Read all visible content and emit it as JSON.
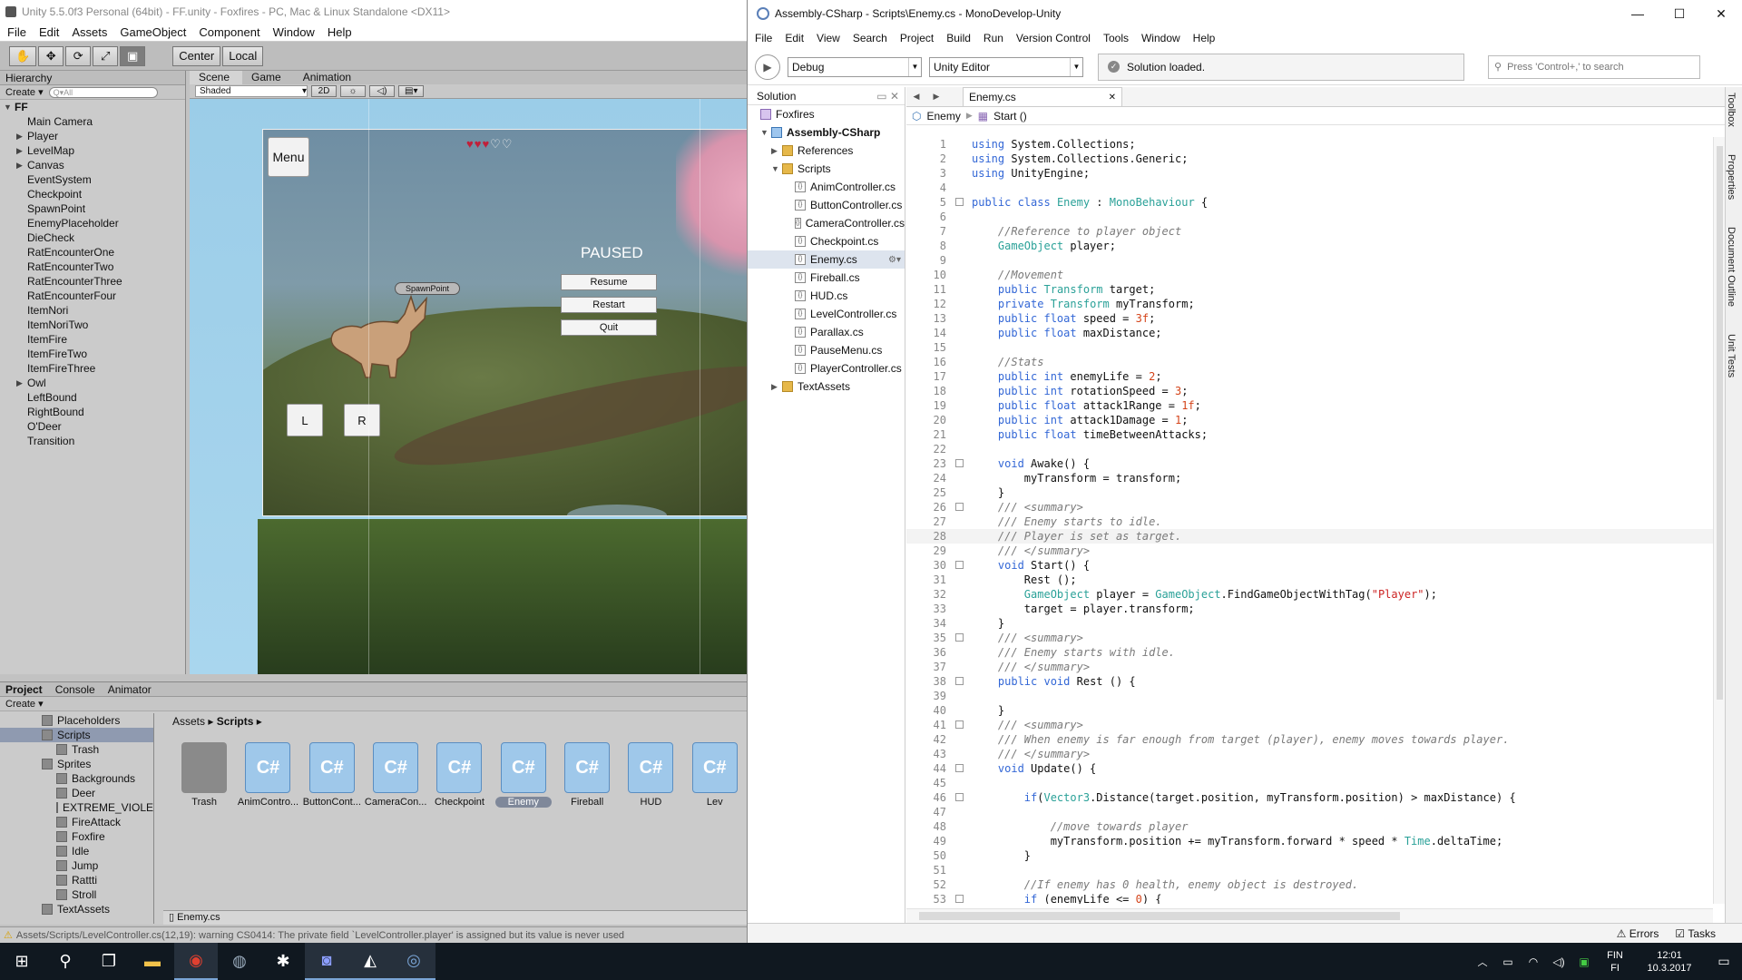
{
  "unity": {
    "title": "Unity 5.5.0f3 Personal (64bit) - FF.unity - Foxfires - PC, Mac & Linux Standalone <DX11>",
    "menu": [
      "File",
      "Edit",
      "Assets",
      "GameObject",
      "Component",
      "Window",
      "Help"
    ],
    "toolbar": {
      "center": "Center",
      "local": "Local"
    },
    "hierarchy": {
      "tab": "Hierarchy",
      "create": "Create ▾",
      "search_placeholder": "Q▾All",
      "scene": "FF",
      "items": [
        "Main Camera",
        "Player",
        "LevelMap",
        "Canvas",
        "EventSystem",
        "Checkpoint",
        "SpawnPoint",
        "EnemyPlaceholder",
        "DieCheck",
        "RatEncounterOne",
        "RatEncounterTwo",
        "RatEncounterThree",
        "RatEncounterFour",
        "ItemNori",
        "ItemNoriTwo",
        "ItemFire",
        "ItemFireTwo",
        "ItemFireThree",
        "Owl",
        "LeftBound",
        "RightBound",
        "O'Deer",
        "Transition"
      ]
    },
    "scene": {
      "tabs": [
        "Scene",
        "Game",
        "Animation"
      ],
      "shading": "Shaded",
      "mode2d": "2D",
      "menu_button": "Menu",
      "paused": "PAUSED",
      "resume": "Resume",
      "restart": "Restart",
      "quit": "Quit",
      "spawnpoint": "SpawnPoint",
      "left": "L",
      "right": "R",
      "hearts_full": 3,
      "hearts_total": 5
    },
    "project": {
      "tabs": [
        "Project",
        "Console",
        "Animator"
      ],
      "create": "Create ▾",
      "tree": [
        "Placeholders",
        "Scripts",
        "Trash",
        "Sprites",
        "Backgrounds",
        "Deer",
        "EXTREME_VIOLENC",
        "FireAttack",
        "Foxfire",
        "Idle",
        "Jump",
        "Rattti",
        "Stroll",
        "TextAssets"
      ],
      "breadcrumb": [
        "Assets",
        "Scripts"
      ],
      "assets": [
        "Trash",
        "AnimContro...",
        "ButtonCont...",
        "CameraCon...",
        "Checkpoint",
        "Enemy",
        "Fireball",
        "HUD",
        "Lev"
      ],
      "selected_file": "Enemy.cs"
    },
    "status": "Assets/Scripts/LevelController.cs(12,19): warning CS0414: The private field `LevelController.player' is assigned but its value is never used"
  },
  "md": {
    "title": "Assembly-CSharp - Scripts\\Enemy.cs - MonoDevelop-Unity",
    "menu": [
      "File",
      "Edit",
      "View",
      "Search",
      "Project",
      "Build",
      "Run",
      "Version Control",
      "Tools",
      "Window",
      "Help"
    ],
    "config": "Debug",
    "target": "Unity Editor",
    "status_msg": "Solution loaded.",
    "search_placeholder": "Press 'Control+,' to search",
    "solution_header": "Solution",
    "solution": {
      "root": "Foxfires",
      "project": "Assembly-CSharp",
      "references": "References",
      "scripts": "Scripts",
      "files": [
        "AnimController.cs",
        "ButtonController.cs",
        "CameraController.cs",
        "Checkpoint.cs",
        "Enemy.cs",
        "Fireball.cs",
        "HUD.cs",
        "LevelController.cs",
        "Parallax.cs",
        "PauseMenu.cs",
        "PlayerController.cs"
      ],
      "textassets": "TextAssets"
    },
    "tab": "Enemy.cs",
    "crumb_class": "Enemy",
    "crumb_method": "Start ()",
    "right_tabs": [
      "Toolbox",
      "Properties",
      "Document Outline",
      "Unit Tests"
    ],
    "bottom": {
      "errors": "Errors",
      "tasks": "Tasks"
    }
  },
  "code": [
    {
      "n": 1,
      "f": 0,
      "h": "<span class='k'>using</span> System.Collections;"
    },
    {
      "n": 2,
      "f": 0,
      "h": "<span class='k'>using</span> System.Collections.Generic;"
    },
    {
      "n": 3,
      "f": 0,
      "h": "<span class='k'>using</span> UnityEngine;"
    },
    {
      "n": 4,
      "f": 0,
      "h": ""
    },
    {
      "n": 5,
      "f": 1,
      "h": "<span class='k'>public class</span> <span class='t'>Enemy</span> : <span class='t'>MonoBehaviour</span> {"
    },
    {
      "n": 6,
      "f": 0,
      "h": ""
    },
    {
      "n": 7,
      "f": 0,
      "h": "    <span class='cm'>//Reference to player object</span>"
    },
    {
      "n": 8,
      "f": 0,
      "h": "    <span class='t'>GameObject</span> player;"
    },
    {
      "n": 9,
      "f": 0,
      "h": ""
    },
    {
      "n": 10,
      "f": 0,
      "h": "    <span class='cm'>//Movement</span>"
    },
    {
      "n": 11,
      "f": 0,
      "h": "    <span class='k'>public</span> <span class='t'>Transform</span> target;"
    },
    {
      "n": 12,
      "f": 0,
      "h": "    <span class='k'>private</span> <span class='t'>Transform</span> myTransform;"
    },
    {
      "n": 13,
      "f": 0,
      "h": "    <span class='k'>public float</span> speed = <span class='n'>3f</span>;"
    },
    {
      "n": 14,
      "f": 0,
      "h": "    <span class='k'>public float</span> maxDistance;"
    },
    {
      "n": 15,
      "f": 0,
      "h": ""
    },
    {
      "n": 16,
      "f": 0,
      "h": "    <span class='cm'>//Stats</span>"
    },
    {
      "n": 17,
      "f": 0,
      "h": "    <span class='k'>public int</span> enemyLife = <span class='n'>2</span>;"
    },
    {
      "n": 18,
      "f": 0,
      "h": "    <span class='k'>public int</span> rotationSpeed = <span class='n'>3</span>;"
    },
    {
      "n": 19,
      "f": 0,
      "h": "    <span class='k'>public float</span> attack1Range = <span class='n'>1f</span>;"
    },
    {
      "n": 20,
      "f": 0,
      "h": "    <span class='k'>public int</span> attack1Damage = <span class='n'>1</span>;"
    },
    {
      "n": 21,
      "f": 0,
      "h": "    <span class='k'>public float</span> timeBetweenAttacks;"
    },
    {
      "n": 22,
      "f": 0,
      "h": ""
    },
    {
      "n": 23,
      "f": 1,
      "h": "    <span class='k'>void</span> Awake() {"
    },
    {
      "n": 24,
      "f": 0,
      "h": "        myTransform = transform;"
    },
    {
      "n": 25,
      "f": 0,
      "h": "    }"
    },
    {
      "n": 26,
      "f": 1,
      "h": "    <span class='cm'>/// &lt;summary&gt;</span>"
    },
    {
      "n": 27,
      "f": 0,
      "h": "    <span class='cm'>/// Enemy starts to idle.</span>"
    },
    {
      "n": 28,
      "f": 0,
      "h": "    <span class='cm'>/// Player is set as target.</span>"
    },
    {
      "n": 29,
      "f": 0,
      "h": "    <span class='cm'>/// &lt;/summary&gt;</span>"
    },
    {
      "n": 30,
      "f": 1,
      "h": "    <span class='k'>void</span> Start() {"
    },
    {
      "n": 31,
      "f": 0,
      "h": "        Rest ();"
    },
    {
      "n": 32,
      "f": 0,
      "h": "        <span class='t'>GameObject</span> player = <span class='t'>GameObject</span>.FindGameObjectWithTag(<span class='s'>\"Player\"</span>);"
    },
    {
      "n": 33,
      "f": 0,
      "h": "        target = player.transform;"
    },
    {
      "n": 34,
      "f": 0,
      "h": "    }"
    },
    {
      "n": 35,
      "f": 1,
      "h": "    <span class='cm'>/// &lt;summary&gt;</span>"
    },
    {
      "n": 36,
      "f": 0,
      "h": "    <span class='cm'>/// Enemy starts with idle.</span>"
    },
    {
      "n": 37,
      "f": 0,
      "h": "    <span class='cm'>/// &lt;/summary&gt;</span>"
    },
    {
      "n": 38,
      "f": 1,
      "h": "    <span class='k'>public void</span> Rest () {"
    },
    {
      "n": 39,
      "f": 0,
      "h": ""
    },
    {
      "n": 40,
      "f": 0,
      "h": "    }"
    },
    {
      "n": 41,
      "f": 1,
      "h": "    <span class='cm'>/// &lt;summary&gt;</span>"
    },
    {
      "n": 42,
      "f": 0,
      "h": "    <span class='cm'>/// When enemy is far enough from target (player), enemy moves towards player.</span>"
    },
    {
      "n": 43,
      "f": 0,
      "h": "    <span class='cm'>/// &lt;/summary&gt;</span>"
    },
    {
      "n": 44,
      "f": 1,
      "h": "    <span class='k'>void</span> Update() {"
    },
    {
      "n": 45,
      "f": 0,
      "h": ""
    },
    {
      "n": 46,
      "f": 1,
      "h": "        <span class='k'>if</span>(<span class='t'>Vector3</span>.Distance(target.position, myTransform.position) &gt; maxDistance) {"
    },
    {
      "n": 47,
      "f": 0,
      "h": ""
    },
    {
      "n": 48,
      "f": 0,
      "h": "            <span class='cm'>//move towards player</span>"
    },
    {
      "n": 49,
      "f": 0,
      "h": "            myTransform.position += myTransform.forward * speed * <span class='t'>Time</span>.deltaTime;"
    },
    {
      "n": 50,
      "f": 0,
      "h": "        }"
    },
    {
      "n": 51,
      "f": 0,
      "h": ""
    },
    {
      "n": 52,
      "f": 0,
      "h": "        <span class='cm'>//If enemy has 0 health, enemy object is destroyed.</span>"
    },
    {
      "n": 53,
      "f": 1,
      "h": "        <span class='k'>if</span> (enemyLife &lt;= <span class='n'>0</span>) {"
    }
  ],
  "taskbar": {
    "lang": "FIN",
    "lang2": "FI",
    "time": "12:01",
    "date": "10.3.2017"
  }
}
